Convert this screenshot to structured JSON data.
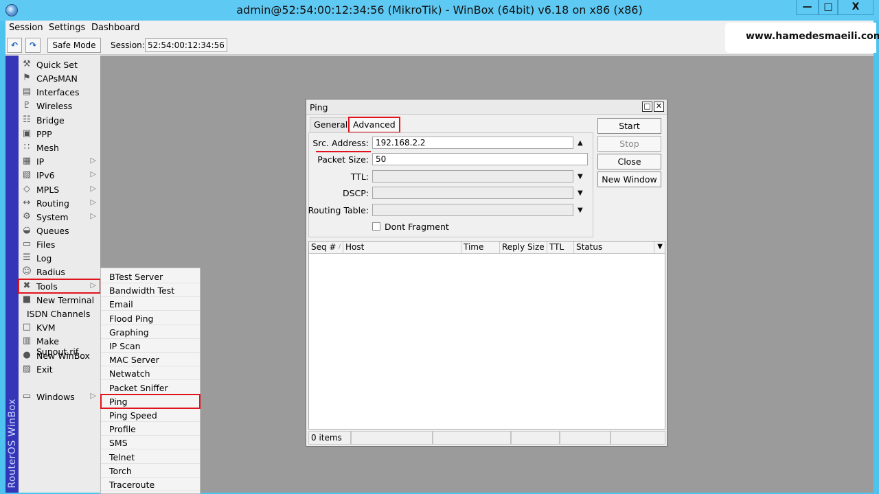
{
  "window": {
    "title": "admin@52:54:00:12:34:56 (MikroTik) - WinBox (64bit) v6.18 on x86 (x86)",
    "min_glyph": "—",
    "max_glyph": "□",
    "close_glyph": "X"
  },
  "menubar": [
    "Session",
    "Settings",
    "Dashboard"
  ],
  "toolbar": {
    "undo_glyph": "↶",
    "redo_glyph": "↷",
    "safe_mode": "Safe Mode",
    "session_label": "Session:",
    "session_value": "52:54:00:12:34:56"
  },
  "watermark": "www.hamedesmaeili.com",
  "brand": "RouterOS WinBox",
  "sidebar": [
    {
      "label": "Quick Set",
      "icon": "quick-set-icon",
      "arrow": false
    },
    {
      "label": "CAPsMAN",
      "icon": "capsman-icon",
      "arrow": false
    },
    {
      "label": "Interfaces",
      "icon": "interfaces-icon",
      "arrow": false
    },
    {
      "label": "Wireless",
      "icon": "wireless-icon",
      "arrow": false
    },
    {
      "label": "Bridge",
      "icon": "bridge-icon",
      "arrow": false
    },
    {
      "label": "PPP",
      "icon": "ppp-icon",
      "arrow": false
    },
    {
      "label": "Mesh",
      "icon": "mesh-icon",
      "arrow": false
    },
    {
      "label": "IP",
      "icon": "ip-icon",
      "arrow": true
    },
    {
      "label": "IPv6",
      "icon": "ipv6-icon",
      "arrow": true
    },
    {
      "label": "MPLS",
      "icon": "mpls-icon",
      "arrow": true
    },
    {
      "label": "Routing",
      "icon": "routing-icon",
      "arrow": true
    },
    {
      "label": "System",
      "icon": "system-icon",
      "arrow": true
    },
    {
      "label": "Queues",
      "icon": "queues-icon",
      "arrow": false
    },
    {
      "label": "Files",
      "icon": "files-icon",
      "arrow": false
    },
    {
      "label": "Log",
      "icon": "log-icon",
      "arrow": false
    },
    {
      "label": "Radius",
      "icon": "radius-icon",
      "arrow": false
    },
    {
      "label": "Tools",
      "icon": "tools-icon",
      "arrow": true
    },
    {
      "label": "New Terminal",
      "icon": "terminal-icon",
      "arrow": false
    },
    {
      "label": "ISDN Channels",
      "icon": "",
      "arrow": false
    },
    {
      "label": "KVM",
      "icon": "kvm-icon",
      "arrow": false
    },
    {
      "label": "Make Supout.rif",
      "icon": "supout-icon",
      "arrow": false
    },
    {
      "label": "New WinBox",
      "icon": "winbox-icon",
      "arrow": false
    },
    {
      "label": "Exit",
      "icon": "exit-icon",
      "arrow": false
    },
    {
      "label": "Windows",
      "icon": "windows-icon",
      "arrow": true
    }
  ],
  "tools_submenu": [
    "BTest Server",
    "Bandwidth Test",
    "Email",
    "Flood Ping",
    "Graphing",
    "IP Scan",
    "MAC Server",
    "Netwatch",
    "Packet Sniffer",
    "Ping",
    "Ping Speed",
    "Profile",
    "SMS",
    "Telnet",
    "Torch",
    "Traceroute"
  ],
  "ping": {
    "title": "Ping",
    "tabs": [
      "General",
      "Advanced"
    ],
    "fields": {
      "src_label": "Src. Address:",
      "src_value": "192.168.2.2",
      "packet_label": "Packet Size:",
      "packet_value": "50",
      "ttl_label": "TTL:",
      "dscp_label": "DSCP:",
      "routing_label": "Routing Table:",
      "dont_fragment": "Dont Fragment"
    },
    "buttons": [
      "Start",
      "Stop",
      "Close",
      "New Window"
    ],
    "columns": [
      "Seq #",
      "Host",
      "Time",
      "Reply Size",
      "TTL",
      "Status"
    ],
    "status": "0 items"
  }
}
